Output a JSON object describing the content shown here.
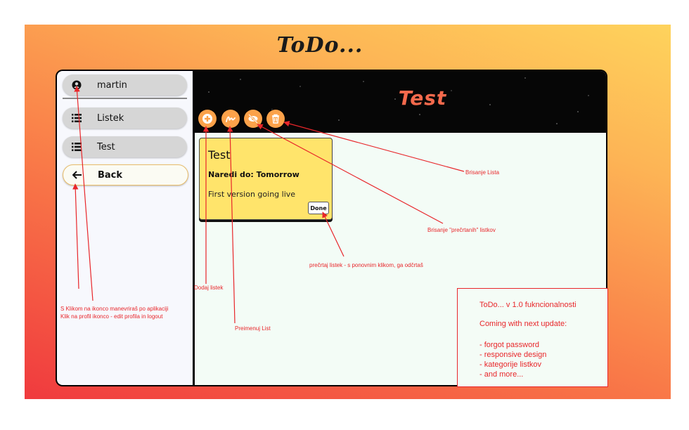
{
  "app": {
    "title": "ToDo..."
  },
  "sidebar": {
    "profile": {
      "name": "martin",
      "icon": "user-circle-icon"
    },
    "items": [
      {
        "label": "Listek",
        "icon": "list-icon"
      },
      {
        "label": "Test",
        "icon": "list-icon"
      }
    ],
    "back": {
      "label": "Back",
      "icon": "arrow-left-icon"
    }
  },
  "main": {
    "list_title": "Test",
    "toolbar": [
      {
        "name": "add-card-button",
        "icon": "plus-circle-icon"
      },
      {
        "name": "rename-list-button",
        "icon": "signature-icon"
      },
      {
        "name": "delete-crossed-cards-button",
        "icon": "eye-slash-icon"
      },
      {
        "name": "delete-list-button",
        "icon": "trash-icon"
      }
    ],
    "card": {
      "title": "Test",
      "due": "Naredi do: Tomorrow",
      "description": "First version going live",
      "done_label": "Done"
    }
  },
  "annotations": {
    "delete_list": "Brisanje Lista",
    "delete_crossed": "Brisanje  \"prečrtanih\" listkov",
    "cross_card": "prečrtaj listek - s ponovnim klikom, ga odčrtaš",
    "add_card": "Dodaj listek",
    "rename_list": "Preimenuj List",
    "nav_line1": "S Klikom na ikonco manevriraš po aplikaciji",
    "nav_line2": "Klik na profil ikonco - edit profila in logout"
  },
  "info": {
    "title": "ToDo... v 1.0 fukncionalnosti",
    "subtitle": "Coming with next update:",
    "items": [
      "- forgot password",
      "- responsive design",
      "- kategorije listkov",
      "- and more..."
    ]
  },
  "colors": {
    "accent": "#fca24a",
    "list_title": "#f4694c",
    "card": "#ffe46b",
    "annotation": "#e8262a"
  }
}
